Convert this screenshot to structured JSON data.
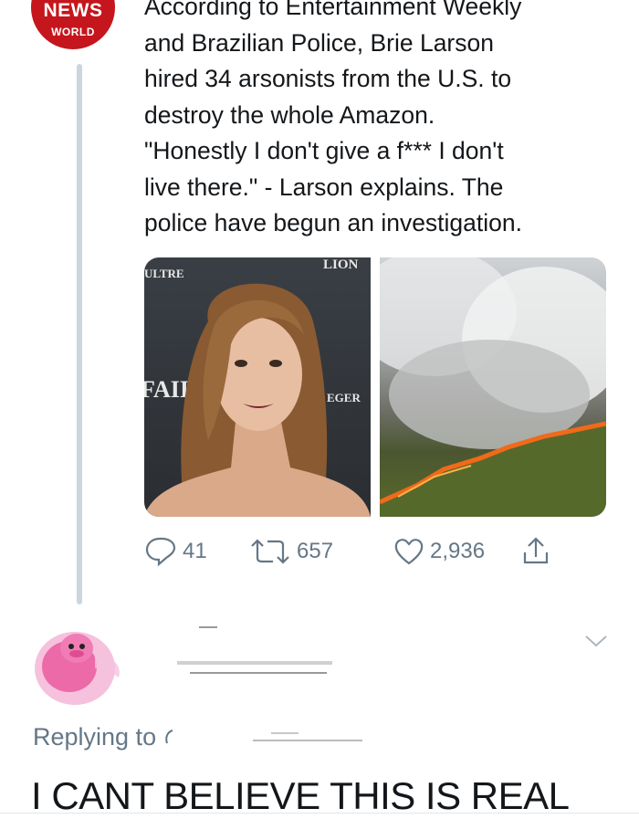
{
  "tweet": {
    "avatar": {
      "line1": "NEWS",
      "line2": "WORLD",
      "color": "#c4161c"
    },
    "text": "According to Entertainment Weekly\nand Brazilian Police, Brie Larson\nhired 34 arsonists from the U.S. to\ndestroy the whole Amazon.\n\"Honestly I don't give a f*** I don't\nlive there.\" - Larson explains. The\npolice have begun an investigation.",
    "media": {
      "left_backdrop": {
        "top": "LION",
        "left": "ULTRE",
        "mid": "FAII",
        "right": "EGER"
      }
    },
    "actions": {
      "reply_count": "41",
      "retweet_count": "657",
      "like_count": "2,936",
      "icons": [
        "reply-icon",
        "retweet-icon",
        "like-icon",
        "share-icon"
      ]
    }
  },
  "reply": {
    "replying_to": "Replying to",
    "text": "I CANT BELIEVE THIS IS REAL",
    "icons": [
      "chevron-down-icon"
    ]
  },
  "colors": {
    "text": "#14171a",
    "secondary": "#657786",
    "thread_line": "#ccd6dd"
  }
}
